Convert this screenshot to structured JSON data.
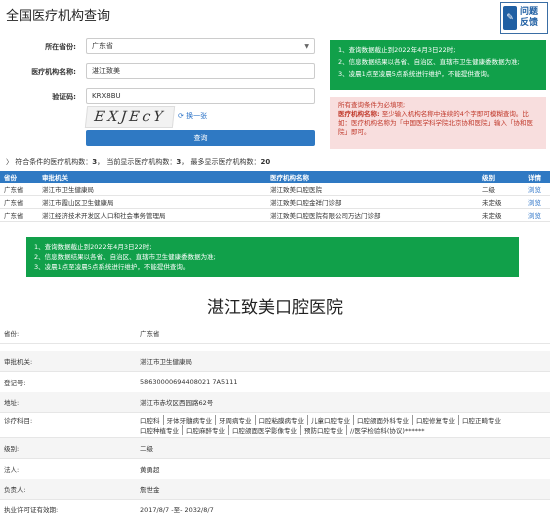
{
  "page": {
    "title": "全国医疗机构查询",
    "help_line1": "问题",
    "help_line2": "反馈",
    "help_icon": "feedback-icon"
  },
  "form": {
    "province_label": "所在省份:",
    "province_value": "广东省",
    "name_label": "医疗机构名称:",
    "name_value": "湛江致美",
    "captcha_label": "验证码:",
    "captcha_value": "KRX8BU",
    "captcha_image_text": "EXJEcY",
    "refresh_label": "换一张",
    "submit_label": "查询"
  },
  "notice": {
    "lines": [
      "1、查询数据截止到2022年4月3日22时;",
      "2、信息数据结果以各省、自治区、直辖市卫生健康委数据为准;",
      "3、凌晨1点至凌晨5点系统进行维护，不能提供查询。"
    ]
  },
  "hint": {
    "line1": "所有查询条件为必填项;",
    "line2_bold": "医疗机构名称:",
    "line2": "至少输入机构名称中连续的4个字即可模糊查询。比如：医疗机构名称为「中国医学科学院北京协和医院」输入「协和医院」即可。"
  },
  "summary": {
    "text": "符合条件的医疗机构数：",
    "count": "3",
    "shown_text": "当前显示医疗机构数：",
    "shown": "3",
    "max_text": "最多显示医疗机构数：",
    "max": "20"
  },
  "table": {
    "headers": [
      "省份",
      "审批机关",
      "医疗机构名称",
      "级别",
      "详情"
    ],
    "rows": [
      [
        "广东省",
        "湛江市卫生健康局",
        "湛江致美口腔医院",
        "二级",
        "浏览"
      ],
      [
        "广东省",
        "湛江市霞山区卫生健康局",
        "湛江致美口腔金祥门诊部",
        "未定级",
        "浏览"
      ],
      [
        "广东省",
        "湛江经济技术开发区人口和社会事务管理局",
        "湛江致美口腔医院有限公司万达门诊部",
        "未定级",
        "浏览"
      ]
    ]
  },
  "detail": {
    "title": "湛江致美口腔医院",
    "rows": [
      {
        "k": "省份:",
        "v": "广东省"
      },
      {
        "k": "审批机关:",
        "v": "湛江市卫生健康局"
      },
      {
        "k": "登记号:",
        "v": "58630000694408021 7A5111"
      },
      {
        "k": "地址:",
        "v": "湛江市赤坎区西园路62号"
      },
      {
        "k": "诊疗科目:",
        "v": ""
      },
      {
        "k": "级别:",
        "v": "二级"
      },
      {
        "k": "法人:",
        "v": "黄勇超"
      },
      {
        "k": "负责人:",
        "v": "詹世金"
      },
      {
        "k": "执业许可证有效期:",
        "v": "2017/8/7 -至- 2032/8/7"
      }
    ],
    "scope_line1": [
      "口腔科",
      "牙体牙髓病专业",
      "牙周病专业",
      "口腔粘膜病专业",
      "儿童口腔专业",
      "口腔颌面外科专业",
      "口腔修复专业",
      "口腔正畸专业"
    ],
    "scope_line2": [
      "口腔种植专业",
      "口腔麻醉专业",
      "口腔颌面医学影像专业",
      "预防口腔专业",
      "//医学检验科(协议)******"
    ]
  },
  "colors": {
    "accent": "#2f79c3",
    "notice_green": "#11a04a",
    "notice_pink": "#f8dede"
  }
}
